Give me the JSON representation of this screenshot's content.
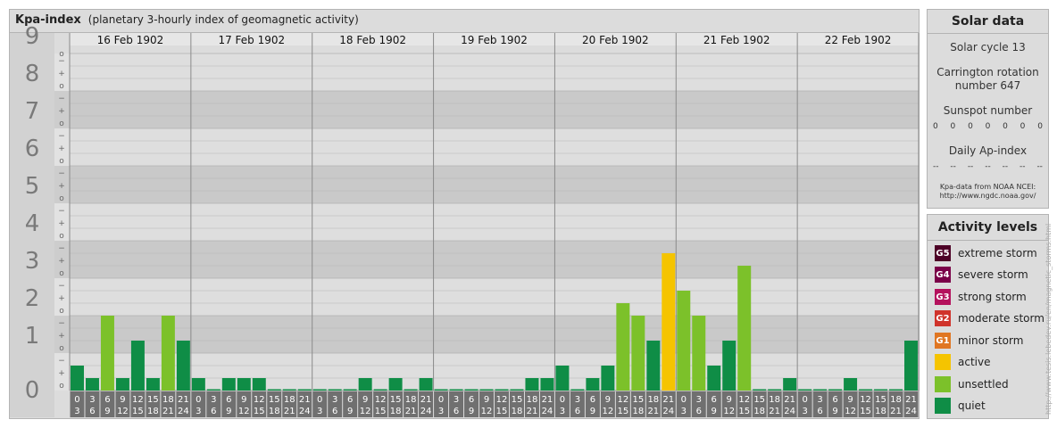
{
  "title": "Kpa-index",
  "subtitle": "(planetary 3-hourly index of geomagnetic activity)",
  "colors": {
    "quiet": "#0f8d46",
    "unsettled": "#7cc12a",
    "active": "#f5c400",
    "minor": "#e07622",
    "moderate": "#d0332b",
    "strong": "#b4125d",
    "severe": "#7a0048",
    "extreme": "#4d0026"
  },
  "solar": {
    "title": "Solar data",
    "cycle": "Solar cycle 13",
    "rotation_line1": "Carrington rotation",
    "rotation_line2": "number 647",
    "sunspot_label": "Sunspot number",
    "sunspot_values": [
      "0",
      "0",
      "0",
      "0",
      "0",
      "0",
      "0"
    ],
    "ap_label": "Daily Ap-index",
    "ap_values": [
      "--",
      "--",
      "--",
      "--",
      "--",
      "--",
      "--"
    ],
    "source_line1": "Kpa-data from NOAA NCEI:",
    "source_line2": "http://www.ngdc.noaa.gov/"
  },
  "levels": {
    "title": "Activity levels",
    "items": [
      {
        "badge": "G5",
        "label": "extreme storm",
        "color": "#4d0026"
      },
      {
        "badge": "G4",
        "label": "severe storm",
        "color": "#7a0048"
      },
      {
        "badge": "G3",
        "label": "strong storm",
        "color": "#b4125d"
      },
      {
        "badge": "G2",
        "label": "moderate storm",
        "color": "#d0332b"
      },
      {
        "badge": "G1",
        "label": "minor storm",
        "color": "#e07622"
      },
      {
        "badge": "",
        "label": "active",
        "color": "#f5c400"
      },
      {
        "badge": "",
        "label": "unsettled",
        "color": "#7cc12a"
      },
      {
        "badge": "",
        "label": "quiet",
        "color": "#0f8d46"
      }
    ]
  },
  "credit": "http://www.tesis.lebedev.ru/en/magnetic_storms.html",
  "chart_data": {
    "type": "bar",
    "title": "Kpa-index",
    "ylim": [
      0,
      9
    ],
    "y_ticks": [
      "0",
      "1",
      "2",
      "3",
      "4",
      "5",
      "6",
      "7",
      "8",
      "9"
    ],
    "sub_ticks": [
      "o",
      "+",
      "−"
    ],
    "days": [
      "16 Feb 1902",
      "17 Feb 1902",
      "18 Feb 1902",
      "19 Feb 1902",
      "20 Feb 1902",
      "21 Feb 1902",
      "22 Feb 1902"
    ],
    "interval_top": [
      "0",
      "3",
      "6",
      "9",
      "12",
      "15",
      "18",
      "21"
    ],
    "interval_bottom": [
      "3",
      "6",
      "9",
      "12",
      "15",
      "18",
      "21",
      "24"
    ],
    "values": [
      [
        0.667,
        0.333,
        2.0,
        0.333,
        1.333,
        0.333,
        2.0,
        1.333
      ],
      [
        0.333,
        0.0,
        0.333,
        0.333,
        0.333,
        0.0,
        0.0,
        0.0
      ],
      [
        0.0,
        0.0,
        0.0,
        0.333,
        0.0,
        0.333,
        0.0,
        0.333
      ],
      [
        0.0,
        0.0,
        0.0,
        0.0,
        0.0,
        0.0,
        0.333,
        0.333
      ],
      [
        0.667,
        0.0,
        0.333,
        0.667,
        2.333,
        2.0,
        1.333,
        3.667
      ],
      [
        2.667,
        2.0,
        0.667,
        1.333,
        3.333,
        0.0,
        0.0,
        0.333
      ],
      [
        0.0,
        0.0,
        0.0,
        0.333,
        0.0,
        0.0,
        0.0,
        1.333
      ]
    ]
  }
}
